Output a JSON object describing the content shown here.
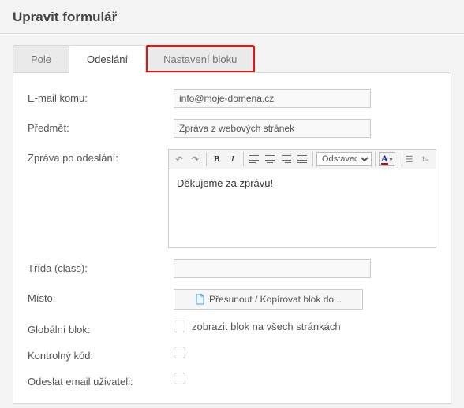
{
  "header": {
    "title": "Upravit formulář"
  },
  "tabs": {
    "fields": "Pole",
    "send": "Odeslání",
    "block_settings": "Nastavení bloku"
  },
  "form": {
    "email_to": {
      "label": "E-mail komu:",
      "value": "info@moje-domena.cz"
    },
    "subject": {
      "label": "Předmět:",
      "value": "Zpráva z webových stránek"
    },
    "message_after": {
      "label": "Zpráva po odeslání:"
    },
    "editor": {
      "format_select": "Odstavec",
      "content": "Děkujeme za zprávu!"
    },
    "class": {
      "label": "Třída (class):",
      "value": ""
    },
    "place": {
      "label": "Místo:",
      "button": "Přesunout / Kopírovat blok do..."
    },
    "global_block": {
      "label": "Globální blok:",
      "checkbox_label": "zobrazit blok na všech stránkách"
    },
    "control_code": {
      "label": "Kontrolný kód:"
    },
    "send_user_email": {
      "label": "Odeslat email uživateli:"
    }
  }
}
